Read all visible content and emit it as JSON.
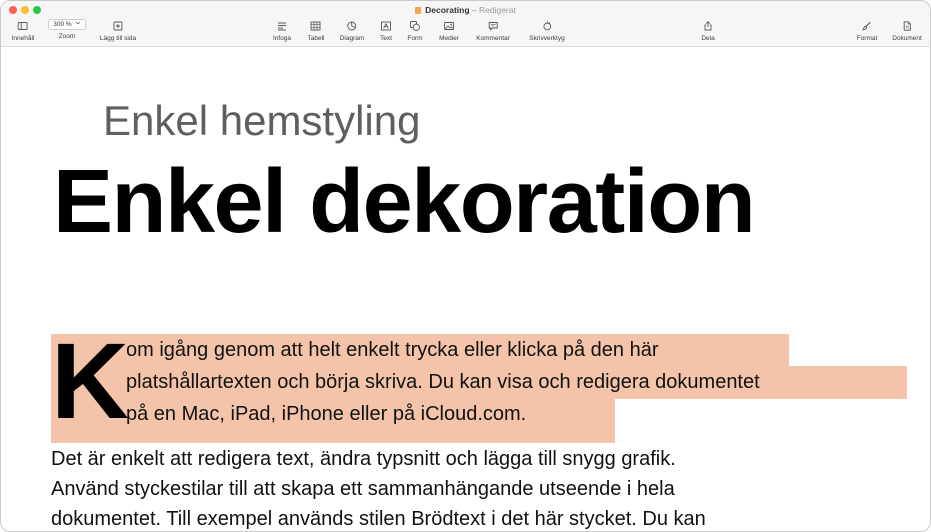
{
  "window": {
    "doc_name": "Decorating",
    "separator": " – ",
    "status": "Redigerat"
  },
  "toolbar": {
    "zoom_value": "300 %",
    "items": {
      "innehall": "Innehåll",
      "zoom": "Zoom",
      "lagg_till_sida": "Lägg till sida",
      "infoga": "Infoga",
      "tabell": "Tabell",
      "diagram": "Diagram",
      "text": "Text",
      "form": "Form",
      "medier": "Medier",
      "kommentar": "Kommentar",
      "skrivverktyg": "Skrivverktyg",
      "dela": "Dela",
      "format": "Format",
      "dokument": "Dokument"
    }
  },
  "document": {
    "subtitle": "Enkel hemstyling",
    "title": "Enkel dekoration",
    "drop_cap": "K",
    "para1": [
      "om igång genom att helt enkelt trycka eller klicka på den här",
      "platshållartexten och börja skriva. Du kan visa och redigera dokumentet",
      "på en Mac, iPad, iPhone eller på iCloud.com."
    ],
    "para2": [
      "Det är enkelt att redigera text, ändra typsnitt och lägga till snygg grafik.",
      "Använd styckestilar till att skapa ett sammanhängande utseende i hela",
      "dokumentet. Till exempel används stilen Brödtext i det här stycket. Du kan"
    ]
  },
  "colors": {
    "selection_highlight": "#f3c3aa",
    "close": "#fe5f57",
    "minimize": "#febc2e",
    "maximize": "#28c840"
  }
}
